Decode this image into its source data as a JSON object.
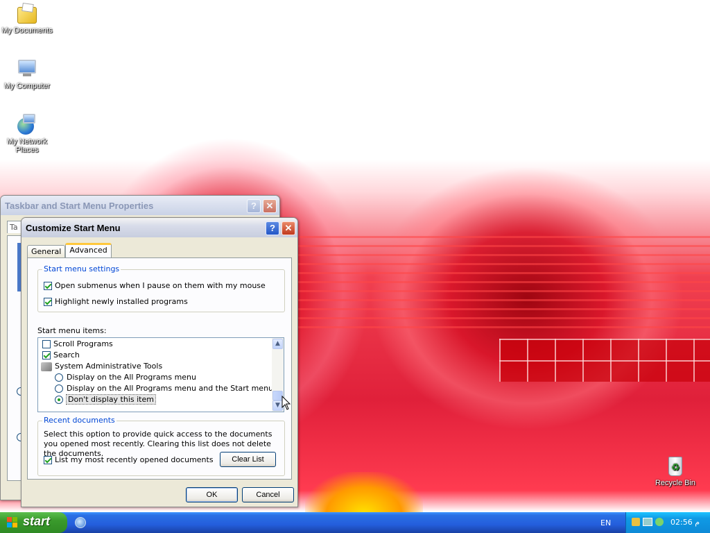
{
  "desktop": {
    "icons": [
      {
        "label": "My Documents"
      },
      {
        "label": "My Computer"
      },
      {
        "label": "My Network Places"
      },
      {
        "label": "Recycle Bin"
      }
    ]
  },
  "parent_window": {
    "title": "Taskbar and Start Menu Properties",
    "help_glyph": "?",
    "close_glyph": "✕",
    "tab_fragment": "Ta"
  },
  "dialog": {
    "title": "Customize Start Menu",
    "help_glyph": "?",
    "close_glyph": "✕",
    "tabs": [
      {
        "label": "General",
        "selected": false
      },
      {
        "label": "Advanced",
        "selected": true
      }
    ],
    "settings_group": {
      "legend": "Start menu settings",
      "options": [
        {
          "label": "Open submenus when I pause on them with my mouse",
          "checked": true
        },
        {
          "label": "Highlight newly installed programs",
          "checked": true
        }
      ]
    },
    "items_label": "Start menu items:",
    "items": [
      {
        "type": "checkbox",
        "label": "Scroll Programs",
        "checked": false
      },
      {
        "type": "checkbox",
        "label": "Search",
        "checked": true
      },
      {
        "type": "header",
        "label": "System Administrative Tools",
        "icon": "admin-tools-icon"
      },
      {
        "type": "radio",
        "label": "Display on the All Programs menu",
        "checked": false
      },
      {
        "type": "radio",
        "label": "Display on the All Programs menu and the Start menu",
        "checked": false
      },
      {
        "type": "radio",
        "label": "Don't display this item",
        "checked": true
      }
    ],
    "recent_group": {
      "legend": "Recent documents",
      "description": "Select this option to provide quick access to the documents you opened most recently.  Clearing this list does not delete the documents.",
      "checkbox_label": "List my most recently opened documents",
      "checkbox_checked": true,
      "clear_button": "Clear List"
    },
    "ok_button": "OK",
    "cancel_button": "Cancel"
  },
  "taskbar": {
    "start_label": "start",
    "language": "EN",
    "clock": "02:56 م"
  },
  "colors": {
    "legend_blue": "#0046d5",
    "taskbar_blue": "#245edc",
    "start_green": "#3a9a2c"
  }
}
